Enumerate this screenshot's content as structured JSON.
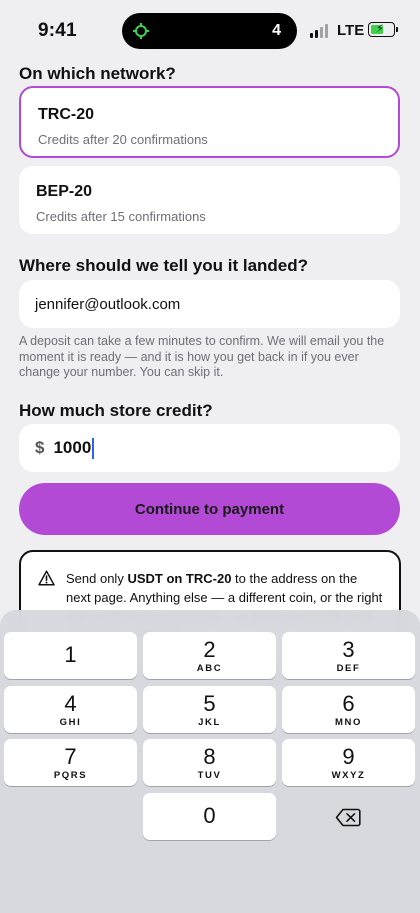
{
  "status": {
    "time": "9:41",
    "activity_count": "4",
    "network": "LTE"
  },
  "network_section": {
    "title": "On which network?",
    "options": [
      {
        "name": "TRC-20",
        "detail": "Credits after 20 confirmations",
        "selected": true
      },
      {
        "name": "BEP-20",
        "detail": "Credits after 15 confirmations",
        "selected": false
      }
    ]
  },
  "email_section": {
    "title": "Where should we tell you it landed?",
    "value": "jennifer@outlook.com",
    "helper": "A deposit can take a few minutes to confirm. We will email you the moment it is ready — and it is how you get back in if you ever change your number. You can skip it."
  },
  "amount_section": {
    "title": "How much store credit?",
    "currency": "$",
    "value": "1000"
  },
  "cta": {
    "label": "Continue to payment"
  },
  "warning": {
    "prefix": "Send only ",
    "token": "USDT on TRC-20",
    "suffix": " to the address on the next page. Anything else — a different coin, or the right coin on the wrong network — is lost permanently and cannot be recovered."
  },
  "keyboard": {
    "keys": [
      {
        "digit": "1",
        "letters": ""
      },
      {
        "digit": "2",
        "letters": "ABC"
      },
      {
        "digit": "3",
        "letters": "DEF"
      },
      {
        "digit": "4",
        "letters": "GHI"
      },
      {
        "digit": "5",
        "letters": "JKL"
      },
      {
        "digit": "6",
        "letters": "MNO"
      },
      {
        "digit": "7",
        "letters": "PQRS"
      },
      {
        "digit": "8",
        "letters": "TUV"
      },
      {
        "digit": "9",
        "letters": "WXYZ"
      },
      {
        "digit": "0",
        "letters": ""
      }
    ]
  },
  "colors": {
    "accent": "#b24ad6",
    "background": "#efeff1",
    "caret": "#2d63f5",
    "battery": "#3cd34a"
  }
}
